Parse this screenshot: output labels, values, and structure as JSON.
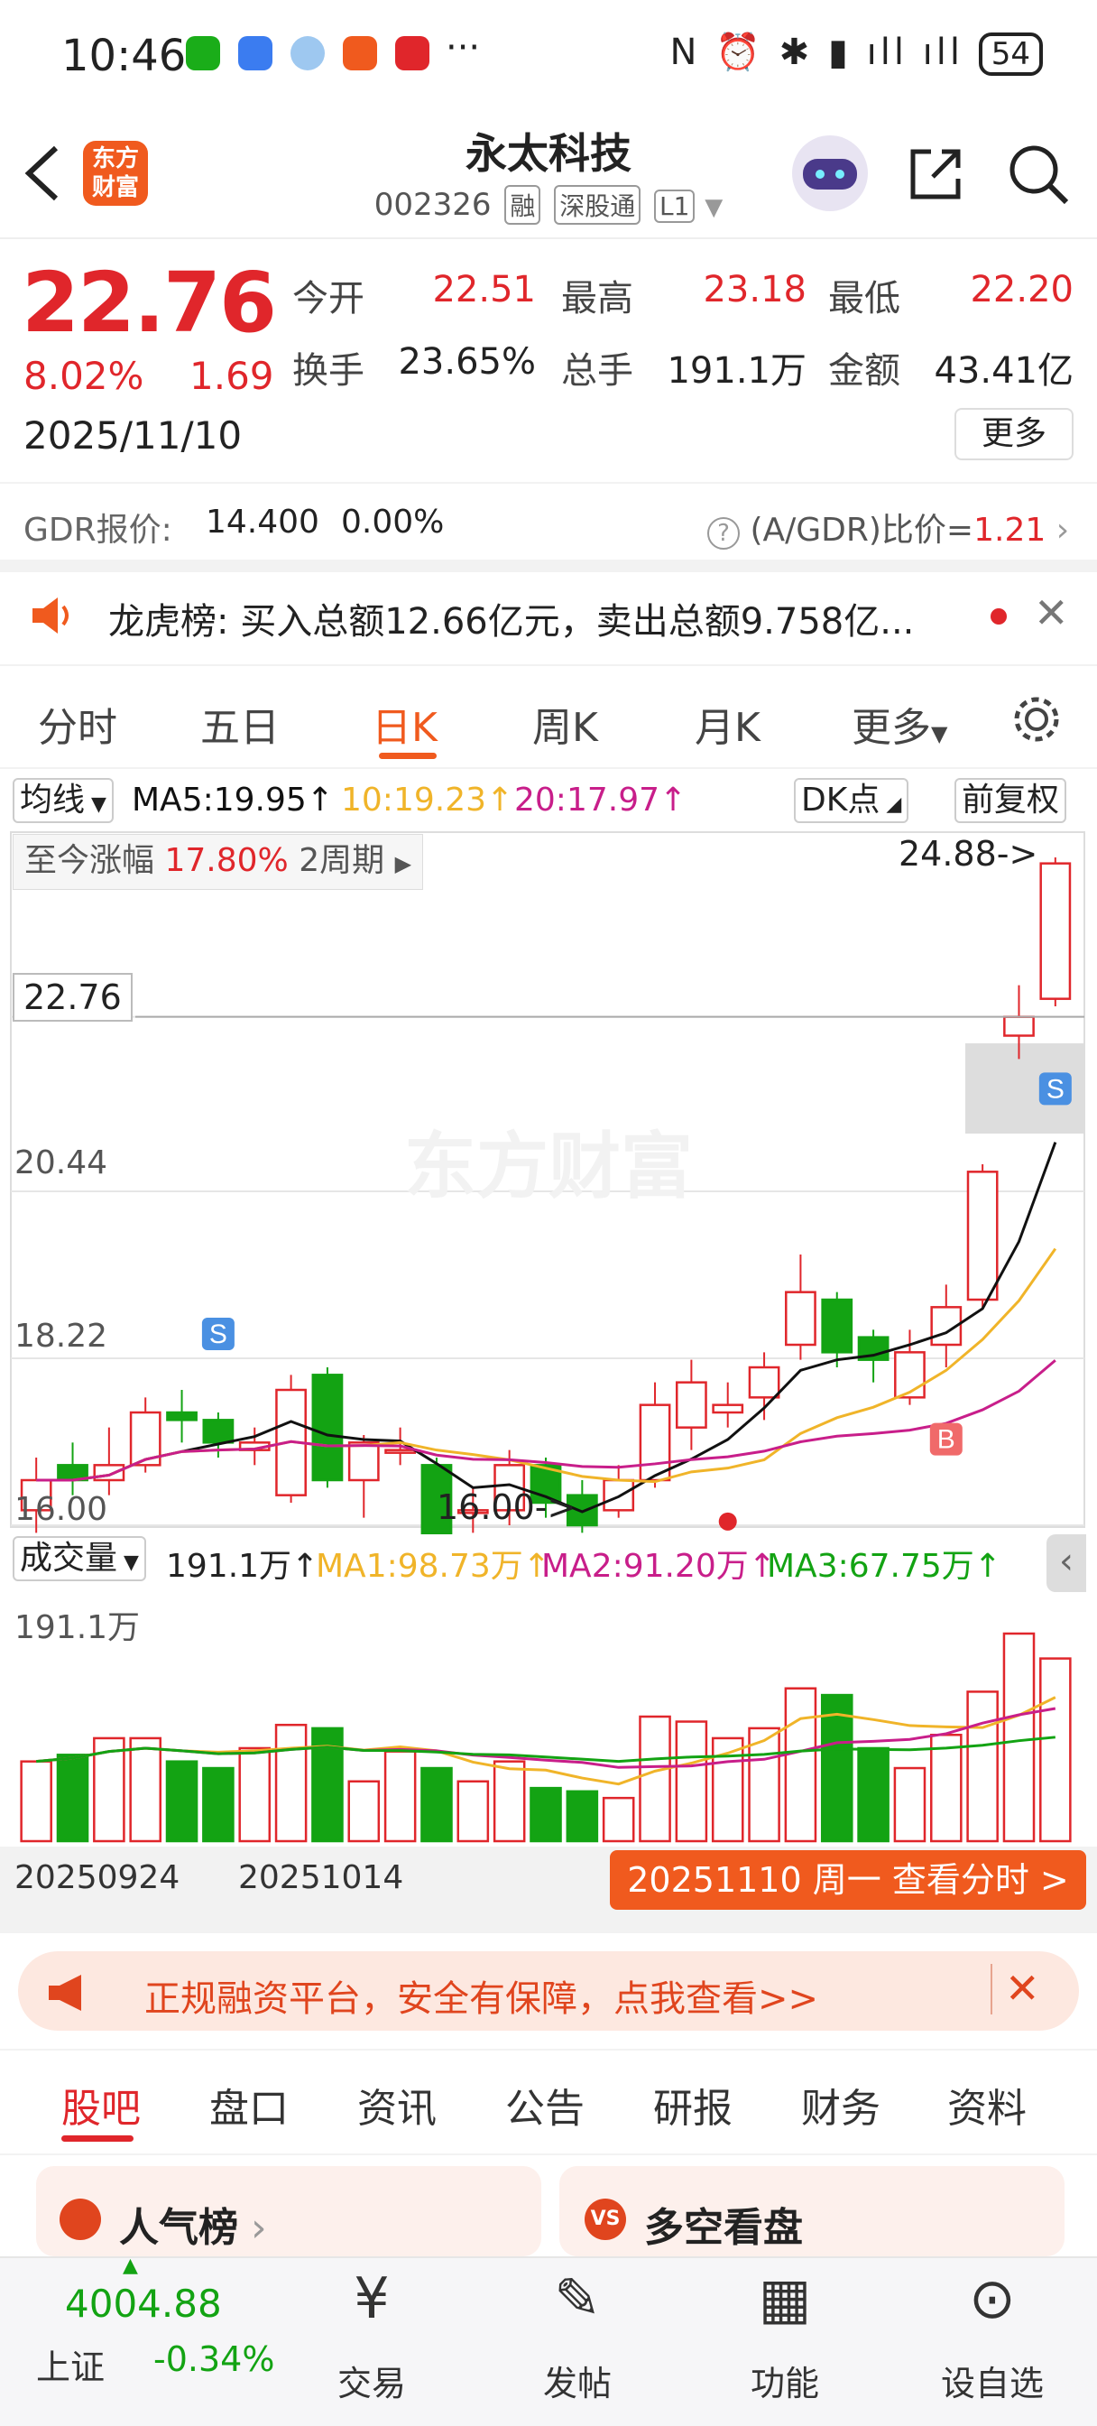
{
  "status_bar": {
    "time": "10:46",
    "battery": "54",
    "more": "···",
    "icons_right": "N ⏰ ✱ ▮ ıll ıll"
  },
  "header": {
    "back_icon": "chevron-left-icon",
    "logo_text_1": "东方",
    "logo_text_2": "财富",
    "stock_name": "永太科技",
    "stock_code": "002326",
    "tags": [
      "融",
      "深股通",
      "L1"
    ]
  },
  "quote": {
    "price": "22.76",
    "change_pct": "8.02%",
    "change": "1.69",
    "date": "2025/11/10",
    "open_label": "今开",
    "open": "22.51",
    "high_label": "最高",
    "high": "23.18",
    "low_label": "最低",
    "low": "22.20",
    "turnover_label": "换手",
    "turnover": "23.65%",
    "volume_label": "总手",
    "volume": "191.1万",
    "amount_label": "金额",
    "amount": "43.41亿",
    "more_label": "更多"
  },
  "gdr": {
    "label": "GDR报价:",
    "price": "14.400",
    "pct": "0.00%",
    "ratio_label": "(A/GDR)比价=",
    "ratio": "1.21"
  },
  "notice": {
    "label": "龙虎榜:",
    "text": "买入总额12.66亿元，卖出总额9.758亿..."
  },
  "chart_tabs": [
    "分时",
    "五日",
    "日K",
    "周K",
    "月K",
    "更多"
  ],
  "active_tab": "日K",
  "ma_bar": {
    "select": "均线",
    "ma5": "MA5:19.95↑",
    "ma10": "10:19.23↑",
    "ma20": "20:17.97↑",
    "dk": "DK点",
    "fq": "前复权"
  },
  "range_info": {
    "label": "至今涨幅",
    "pct": "17.80%",
    "period": "2周期"
  },
  "price_axis": {
    "top_marker": "24.88->",
    "current": "22.76",
    "mid": "20.44",
    "low_mid": "18.22",
    "bottom": "16.00",
    "min_marker": "16.00->"
  },
  "watermark": "东方财富",
  "volume_bar": {
    "select": "成交量",
    "value": "191.1万↑",
    "ma1": "MA1:98.73万↑",
    "ma2": "MA2:91.20万↑",
    "ma3": "MA3:67.75万↑",
    "axis_max": "191.1万"
  },
  "x_labels": [
    "20250924",
    "20251014"
  ],
  "fenshi_button": "20251110 周一 查看分时 >",
  "banner": {
    "text": "正规融资平台，安全有保障，点我查看>>"
  },
  "bottom_tabs": [
    "股吧",
    "盘口",
    "资讯",
    "公告",
    "研报",
    "财务",
    "资料"
  ],
  "cards": [
    {
      "label": "人气榜"
    },
    {
      "label": "多空看盘"
    }
  ],
  "footer": {
    "index_value": "4004.88",
    "index_name": "上证",
    "index_change": "-0.34%",
    "items": [
      {
        "label": "交易",
        "icon": "yen-icon"
      },
      {
        "label": "发帖",
        "icon": "edit-icon"
      },
      {
        "label": "功能",
        "icon": "grid-icon"
      },
      {
        "label": "设自选",
        "icon": "more-icon"
      }
    ]
  },
  "colors": {
    "up": "#e0262b",
    "down": "#13a313",
    "brand": "#f05a1e",
    "ma5": "#111111",
    "ma10": "#f0b429",
    "ma20": "#c81e8a"
  },
  "chart_data": {
    "type": "candlestick",
    "ylim": [
      16.0,
      24.88
    ],
    "y_ticks": [
      16.0,
      18.22,
      20.44,
      22.76
    ],
    "candles": [
      {
        "o": 16.2,
        "c": 16.6,
        "h": 16.9,
        "l": 15.9
      },
      {
        "o": 16.8,
        "c": 16.6,
        "h": 17.1,
        "l": 16.4
      },
      {
        "o": 16.6,
        "c": 16.8,
        "h": 17.3,
        "l": 16.4
      },
      {
        "o": 16.8,
        "c": 17.5,
        "h": 17.7,
        "l": 16.7
      },
      {
        "o": 17.5,
        "c": 17.4,
        "h": 17.8,
        "l": 17.1
      },
      {
        "o": 17.4,
        "c": 17.1,
        "h": 17.5,
        "l": 16.9
      },
      {
        "o": 17.0,
        "c": 17.1,
        "h": 17.3,
        "l": 16.8
      },
      {
        "o": 16.4,
        "c": 17.8,
        "h": 18.0,
        "l": 16.3
      },
      {
        "o": 18.0,
        "c": 16.6,
        "h": 18.1,
        "l": 16.5
      },
      {
        "o": 16.6,
        "c": 17.1,
        "h": 17.2,
        "l": 16.1
      },
      {
        "o": 17.0,
        "c": 17.0,
        "h": 17.3,
        "l": 16.8
      },
      {
        "o": 16.8,
        "c": 15.6,
        "h": 16.9,
        "l": 15.5
      },
      {
        "o": 16.2,
        "c": 16.2,
        "h": 16.5,
        "l": 15.9
      },
      {
        "o": 16.2,
        "c": 16.8,
        "h": 17.0,
        "l": 16.0
      },
      {
        "o": 16.8,
        "c": 16.3,
        "h": 16.9,
        "l": 16.1
      },
      {
        "o": 16.4,
        "c": 16.0,
        "h": 16.6,
        "l": 15.9
      },
      {
        "o": 16.2,
        "c": 16.6,
        "h": 16.8,
        "l": 16.1
      },
      {
        "o": 16.6,
        "c": 17.6,
        "h": 17.9,
        "l": 16.5
      },
      {
        "o": 17.3,
        "c": 17.9,
        "h": 18.2,
        "l": 17.0
      },
      {
        "o": 17.5,
        "c": 17.6,
        "h": 17.9,
        "l": 17.3
      },
      {
        "o": 17.7,
        "c": 18.1,
        "h": 18.3,
        "l": 17.4
      },
      {
        "o": 18.4,
        "c": 19.1,
        "h": 19.6,
        "l": 18.2
      },
      {
        "o": 19.0,
        "c": 18.3,
        "h": 19.1,
        "l": 18.1
      },
      {
        "o": 18.5,
        "c": 18.2,
        "h": 18.6,
        "l": 17.9
      },
      {
        "o": 17.7,
        "c": 18.3,
        "h": 18.6,
        "l": 17.6
      },
      {
        "o": 18.4,
        "c": 18.9,
        "h": 19.2,
        "l": 18.1
      },
      {
        "o": 19.0,
        "c": 20.7,
        "h": 20.8,
        "l": 18.9
      },
      {
        "o": 22.51,
        "c": 22.76,
        "h": 23.18,
        "l": 22.2
      },
      {
        "o": 23.0,
        "c": 24.8,
        "h": 24.88,
        "l": 22.9
      }
    ],
    "volume": [
      48,
      52,
      62,
      62,
      48,
      44,
      56,
      70,
      68,
      36,
      54,
      44,
      36,
      48,
      32,
      30,
      26,
      75,
      72,
      62,
      68,
      92,
      88,
      56,
      44,
      64,
      90,
      125,
      110
    ]
  }
}
